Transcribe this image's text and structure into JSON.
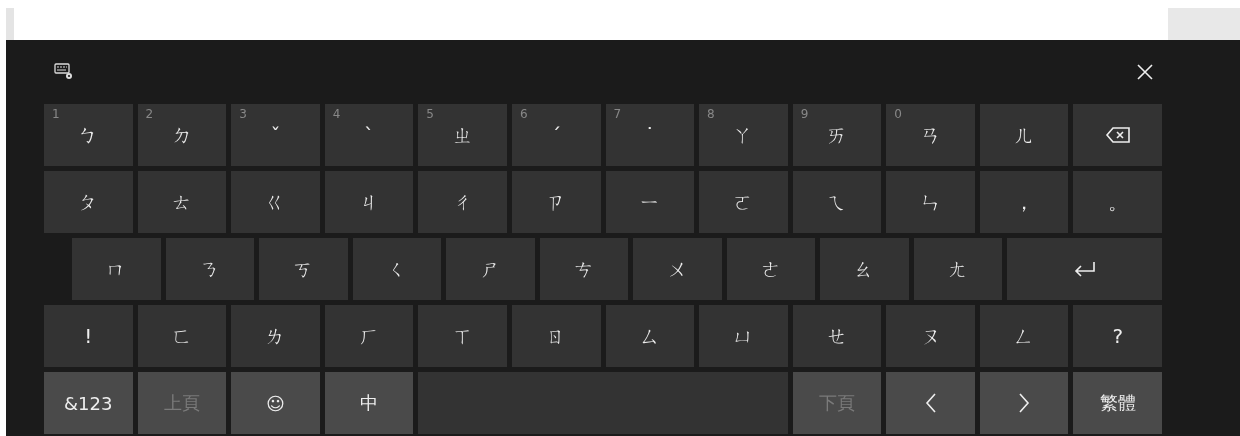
{
  "rows": [
    {
      "keys": [
        {
          "kind": "char",
          "number": "1",
          "label": "ㄅ"
        },
        {
          "kind": "char",
          "number": "2",
          "label": "ㄉ"
        },
        {
          "kind": "char",
          "number": "3",
          "label": "ˇ"
        },
        {
          "kind": "char",
          "number": "4",
          "label": "ˋ"
        },
        {
          "kind": "char",
          "number": "5",
          "label": "ㄓ"
        },
        {
          "kind": "char",
          "number": "6",
          "label": "ˊ"
        },
        {
          "kind": "char",
          "number": "7",
          "label": "˙"
        },
        {
          "kind": "char",
          "number": "8",
          "label": "ㄚ"
        },
        {
          "kind": "char",
          "number": "9",
          "label": "ㄞ"
        },
        {
          "kind": "char",
          "number": "0",
          "label": "ㄢ"
        },
        {
          "kind": "char",
          "label": "ㄦ"
        },
        {
          "kind": "backspace"
        }
      ]
    },
    {
      "keys": [
        {
          "kind": "char",
          "label": "ㄆ"
        },
        {
          "kind": "char",
          "label": "ㄊ"
        },
        {
          "kind": "char",
          "label": "ㄍ"
        },
        {
          "kind": "char",
          "label": "ㄐ"
        },
        {
          "kind": "char",
          "label": "ㄔ"
        },
        {
          "kind": "char",
          "label": "ㄗ"
        },
        {
          "kind": "char",
          "label": "ㄧ"
        },
        {
          "kind": "char",
          "label": "ㄛ"
        },
        {
          "kind": "char",
          "label": "ㄟ"
        },
        {
          "kind": "char",
          "label": "ㄣ"
        },
        {
          "kind": "char",
          "label": "，"
        },
        {
          "kind": "char",
          "label": "。"
        }
      ]
    },
    {
      "keys": [
        {
          "kind": "char",
          "label": "ㄇ"
        },
        {
          "kind": "char",
          "label": "ㄋ"
        },
        {
          "kind": "char",
          "label": "ㄎ"
        },
        {
          "kind": "char",
          "label": "ㄑ"
        },
        {
          "kind": "char",
          "label": "ㄕ"
        },
        {
          "kind": "char",
          "label": "ㄘ"
        },
        {
          "kind": "char",
          "label": "ㄨ"
        },
        {
          "kind": "char",
          "label": "ㄜ"
        },
        {
          "kind": "char",
          "label": "ㄠ"
        },
        {
          "kind": "char",
          "label": "ㄤ"
        },
        {
          "kind": "enter"
        }
      ]
    },
    {
      "keys": [
        {
          "kind": "char",
          "label": "!"
        },
        {
          "kind": "char",
          "label": "ㄈ"
        },
        {
          "kind": "char",
          "label": "ㄌ"
        },
        {
          "kind": "char",
          "label": "ㄏ"
        },
        {
          "kind": "char",
          "label": "ㄒ"
        },
        {
          "kind": "char",
          "label": "ㄖ"
        },
        {
          "kind": "char",
          "label": "ㄙ"
        },
        {
          "kind": "char",
          "label": "ㄩ"
        },
        {
          "kind": "char",
          "label": "ㄝ"
        },
        {
          "kind": "char",
          "label": "ㄡ"
        },
        {
          "kind": "char",
          "label": "ㄥ"
        },
        {
          "kind": "char",
          "label": "?"
        }
      ]
    },
    {
      "keys": [
        {
          "kind": "function",
          "label": "&123",
          "disabled": false
        },
        {
          "kind": "function",
          "label": "上頁",
          "disabled": true
        },
        {
          "kind": "function",
          "label": "☺",
          "disabled": false
        },
        {
          "kind": "function",
          "label": "中",
          "disabled": false
        },
        {
          "kind": "space"
        },
        {
          "kind": "function",
          "label": "下頁",
          "disabled": true
        },
        {
          "kind": "left",
          "disabled": false
        },
        {
          "kind": "right",
          "disabled": false
        },
        {
          "kind": "function",
          "label": "繁體",
          "disabled": false
        }
      ]
    }
  ]
}
